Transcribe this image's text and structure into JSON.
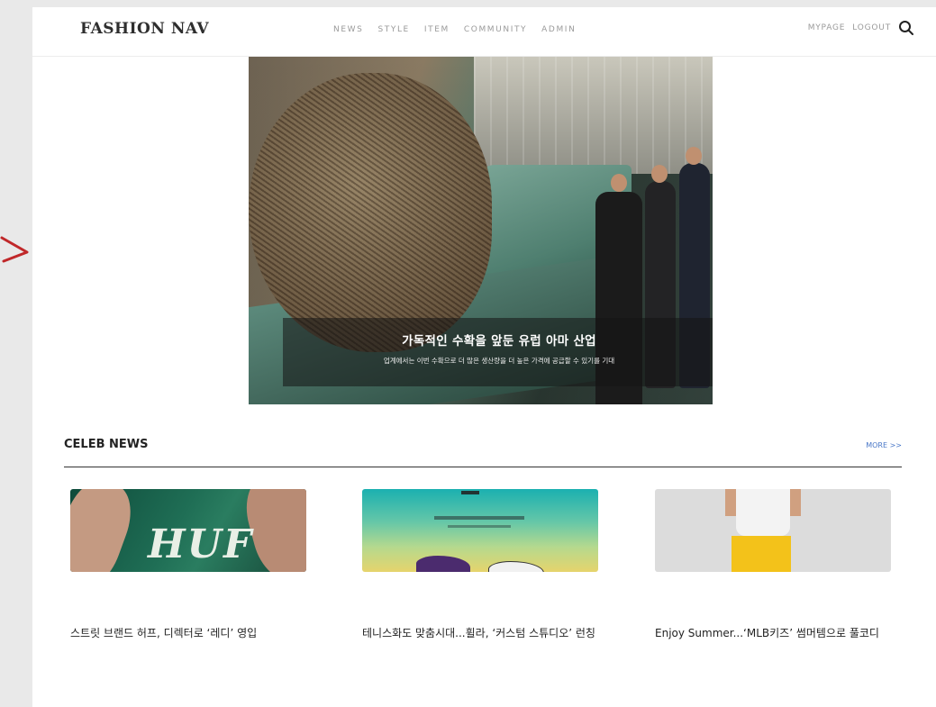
{
  "header": {
    "brand": "FASHION NAV",
    "nav": [
      "NEWS",
      "STYLE",
      "ITEM",
      "COMMUNITY",
      "ADMIN"
    ],
    "mypage": "MYPAGE",
    "logout": "LOGOUT",
    "search_icon": "search-icon"
  },
  "hero": {
    "title": "가독적인 수확을 앞둔 유럽 아마 산업",
    "subtitle": "업계에서는 이번 수확으로 더 많은 생산량을 더 높은 가격에 공급할 수 있기를 기대"
  },
  "celeb_news": {
    "title": "CELEB NEWS",
    "more": "MORE >>",
    "cards": [
      {
        "headline": "스트릿 브랜드 허프, 디렉터로 ‘레디’ 영입",
        "thumb_text": "HUF"
      },
      {
        "headline": "테니스화도 맞춤시대...휠라, ‘커스텀 스튜디오’ 런칭"
      },
      {
        "headline": "Enjoy Summer...‘MLB키즈’ 썸머템으로 풀코디"
      }
    ]
  },
  "colors": {
    "accent_link": "#4a78c8",
    "annotation_arrow": "#c0282a"
  }
}
